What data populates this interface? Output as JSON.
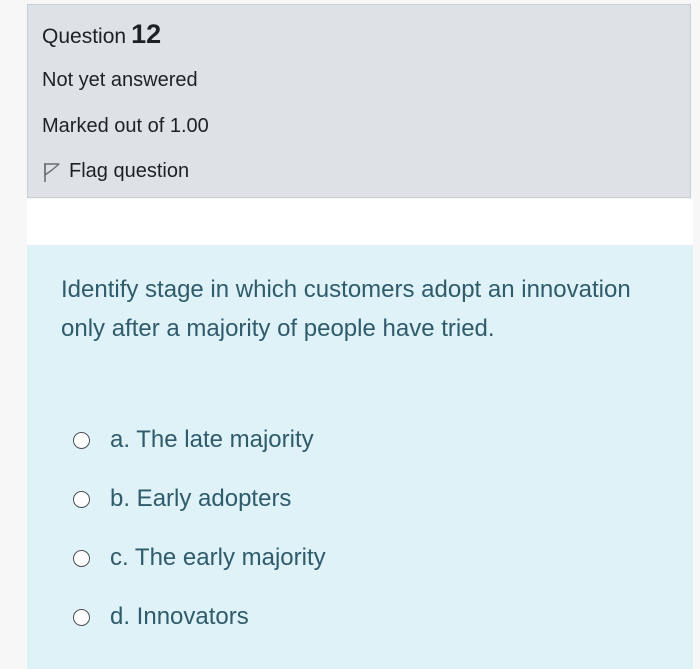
{
  "question_info": {
    "label": "Question",
    "number": "12",
    "state": "Not yet answered",
    "grade": "Marked out of 1.00",
    "flag_label": "Flag question"
  },
  "question": {
    "text": "Identify stage in which customers adopt an innovation only after a majority of people have tried.",
    "answers": [
      {
        "label": "a. The late majority"
      },
      {
        "label": "b. Early adopters"
      },
      {
        "label": "c. The early majority"
      },
      {
        "label": "d. Innovators"
      }
    ]
  },
  "icons": {
    "flag": "flag-icon",
    "radio": "radio-unchecked-icon"
  },
  "colors": {
    "info_background": "#dee2e6",
    "content_background": "#def2f8",
    "question_text": "#2f5b6b",
    "info_text": "#1d2125"
  }
}
